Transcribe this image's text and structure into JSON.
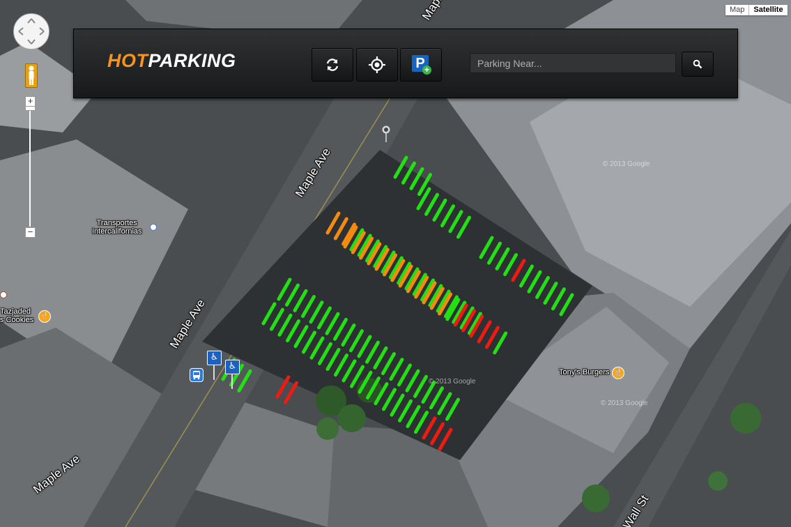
{
  "app": {
    "logo_hot": "HOT",
    "logo_parking": "PARKING"
  },
  "toolbar": {
    "buttons": [
      {
        "icon": "refresh-icon"
      },
      {
        "icon": "locate-icon"
      },
      {
        "icon": "add-parking-icon",
        "glyph": "P",
        "badge": "+"
      }
    ],
    "search_placeholder": "Parking Near...",
    "search_value": "",
    "search_icon": "search-icon"
  },
  "map_type": {
    "map_label": "Map",
    "satellite_label": "Satellite",
    "selected": "Satellite"
  },
  "zoom": {
    "in_label": "+",
    "out_label": "−"
  },
  "labels": {
    "maple_ave_1": "Maple Ave",
    "maple_ave_2": "Maple Ave",
    "maple_ave_3": "Maple Ave",
    "maple_ave_4": "Maple Ave",
    "wall_st": "Wall St",
    "transportes_line1": "Transportes",
    "transportes_line2": "Intercalifornias",
    "tazjaded_line1": "Tazjaded",
    "tazjaded_line2": "s Cookies",
    "tonys_burgers": "Tony's Burgers"
  },
  "watermarks": [
    "© 2013 Google",
    "© 2013 Google",
    "© 2013 Google"
  ],
  "parking_status": {
    "colors": {
      "available": "#22e014",
      "limited": "#f58a10",
      "occupied": "#ef1a12"
    }
  },
  "colors": {
    "accent": "#f7931e",
    "topbar": "#1e2022"
  }
}
